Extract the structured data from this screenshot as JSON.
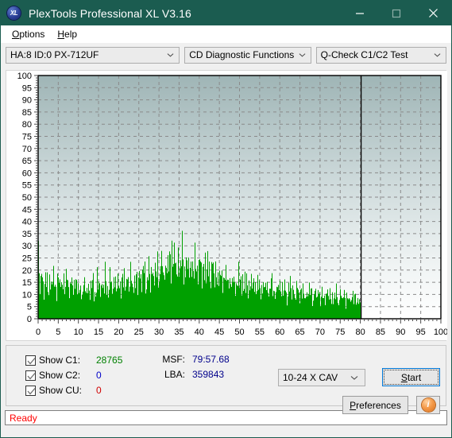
{
  "window": {
    "title": "PlexTools Professional XL V3.16",
    "logo_text": "XL",
    "logo_icon": "xl-logo-icon",
    "minimize_icon": "minimize-icon",
    "maximize_icon": "maximize-icon",
    "close_icon": "close-icon",
    "titlebar_color": "#1b5c50"
  },
  "menu": {
    "items": [
      {
        "label": "Options",
        "mnemonic": "O",
        "rest": "ptions"
      },
      {
        "label": "Help",
        "mnemonic": "H",
        "rest": "elp"
      }
    ]
  },
  "toolbar": {
    "drive_selector": {
      "value": "HA:8 ID:0  PX-712UF",
      "icon": "chevron-down-icon"
    },
    "function_selector": {
      "value": "CD Diagnostic Functions",
      "icon": "chevron-down-icon"
    },
    "test_selector": {
      "value": "Q-Check C1/C2 Test",
      "icon": "chevron-down-icon"
    }
  },
  "controls": {
    "checkboxes": [
      {
        "label": "Show C1:",
        "value": "28765",
        "color": "#008000",
        "checked": true
      },
      {
        "label": "Show C2:",
        "value": "0",
        "color": "#0000c8",
        "checked": true
      },
      {
        "label": "Show CU:",
        "value": "0",
        "color": "#d00000",
        "checked": true
      }
    ],
    "msf_label": "MSF:",
    "msf_value": "79:57.68",
    "lba_label": "LBA:",
    "lba_value": "359843",
    "speed_selector": {
      "value": "10-24 X CAV",
      "icon": "chevron-down-icon"
    },
    "start_button": {
      "label": "Start",
      "mnemonic": "S",
      "rest": "tart"
    },
    "preferences_button": {
      "label": "Preferences",
      "mnemonic": "P",
      "rest": "references"
    },
    "info_button": {
      "icon": "info-icon",
      "glyph": "i"
    }
  },
  "status": {
    "text": "Ready",
    "color": "#ff0000"
  },
  "chart_data": {
    "type": "bar",
    "title": "",
    "xlabel": "",
    "ylabel": "",
    "xlim": [
      0,
      100
    ],
    "ylim": [
      0,
      100
    ],
    "xticks": [
      0,
      5,
      10,
      15,
      20,
      25,
      30,
      35,
      40,
      45,
      50,
      55,
      60,
      65,
      70,
      75,
      80,
      85,
      90,
      95,
      100
    ],
    "yticks": [
      0,
      5,
      10,
      15,
      20,
      25,
      30,
      35,
      40,
      45,
      50,
      55,
      60,
      65,
      70,
      75,
      80,
      85,
      90,
      95,
      100
    ],
    "grid": true,
    "legend": "none",
    "series": [
      {
        "name": "C1 errors",
        "color": "#00a000",
        "x_start": 0,
        "x_end": 80.2,
        "marker_line_x": 80.2,
        "values": [
          32,
          13,
          12,
          16,
          20,
          14,
          13,
          15,
          12,
          17,
          11,
          16,
          14,
          13,
          18,
          16,
          12,
          15,
          13,
          17,
          14,
          11,
          19,
          15,
          13,
          16,
          12,
          14,
          18,
          13,
          17,
          12,
          15,
          13,
          11,
          16,
          14,
          17,
          12,
          15,
          9,
          12,
          10,
          14,
          11,
          16,
          9,
          13,
          12,
          15,
          11,
          10,
          14,
          12,
          16,
          11,
          13,
          9,
          15,
          12,
          17,
          13,
          11,
          16,
          14,
          10,
          18,
          12,
          15,
          13,
          11,
          17,
          14,
          12,
          16,
          13,
          19,
          11,
          15,
          12,
          14,
          17,
          13,
          16,
          12,
          18,
          15,
          13,
          20,
          14,
          12,
          17,
          16,
          13,
          19,
          15,
          11,
          18,
          14,
          16,
          21,
          17,
          14,
          19,
          16,
          22,
          15,
          18,
          13,
          20,
          17,
          14,
          23,
          19,
          16,
          21,
          18,
          15,
          24,
          20,
          17,
          22,
          19,
          25,
          16,
          21,
          18,
          26,
          22,
          19,
          24,
          21,
          35,
          23,
          20,
          26,
          22,
          18,
          25,
          21,
          24,
          20,
          27,
          23,
          19,
          26,
          22,
          18,
          24,
          20,
          23,
          19,
          25,
          21,
          17,
          23,
          20,
          26,
          22,
          18,
          24,
          20,
          17,
          22,
          19,
          25,
          16,
          21,
          18,
          23,
          20,
          17,
          22,
          19,
          16,
          21,
          18,
          15,
          20,
          17,
          14,
          19,
          16,
          22,
          13,
          18,
          15,
          20,
          12,
          17,
          14,
          19,
          11,
          16,
          13,
          18,
          15,
          12,
          17,
          14,
          19,
          11,
          16,
          13,
          18,
          10,
          15,
          12,
          17,
          14,
          11,
          16,
          13,
          18,
          10,
          15,
          12,
          17,
          9,
          14,
          11,
          16,
          13,
          10,
          15,
          12,
          17,
          9,
          14,
          11,
          16,
          13,
          10,
          15,
          12,
          8,
          14,
          11,
          16,
          13,
          10,
          15,
          12,
          9,
          14,
          11,
          8,
          13,
          10,
          15,
          12,
          9,
          14,
          11,
          8,
          13,
          10,
          12,
          9,
          14,
          11,
          8,
          13,
          10,
          7,
          12,
          9,
          14,
          11,
          8,
          13,
          10,
          7,
          12,
          9,
          11,
          8,
          13,
          10,
          7,
          12,
          9,
          6,
          11,
          8,
          13,
          10,
          7,
          12,
          9,
          6,
          11,
          8,
          10,
          7,
          12,
          9,
          6,
          11,
          8,
          10,
          7,
          12,
          9,
          6,
          11,
          8,
          5,
          10,
          7,
          12,
          9,
          6,
          11,
          8,
          5,
          10,
          7,
          9,
          6
        ]
      }
    ]
  }
}
